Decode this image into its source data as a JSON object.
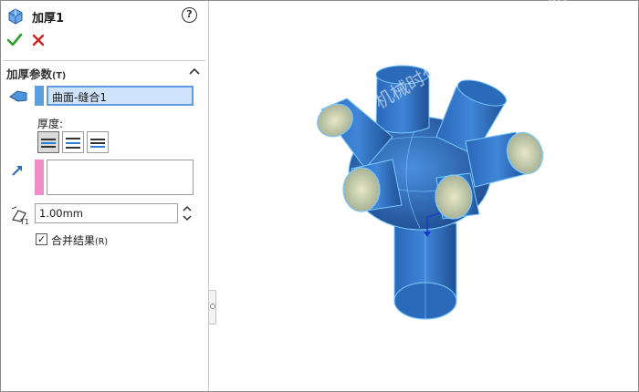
{
  "feature": {
    "title": "加厚1",
    "help": "?"
  },
  "group": {
    "title": "加厚参数",
    "shortcut": "(T)"
  },
  "selection": {
    "item": "曲面-缝合1"
  },
  "thickness": {
    "label": "厚度:",
    "value": "1.00mm"
  },
  "merge": {
    "label": "合并结果",
    "shortcut": "(R)",
    "checked": true
  },
  "watermark": "机械时代网  www.jxage.com",
  "colors": {
    "accept": "#2e9e2e",
    "cancel": "#d42020",
    "selection_fill": "#cfe3fb",
    "selection_border": "#5e9be0",
    "face_swatch": "#5b9fde",
    "direction_swatch": "#f08cc8",
    "model_body": "#2f74c9",
    "model_edges": "#7cc8ff"
  }
}
